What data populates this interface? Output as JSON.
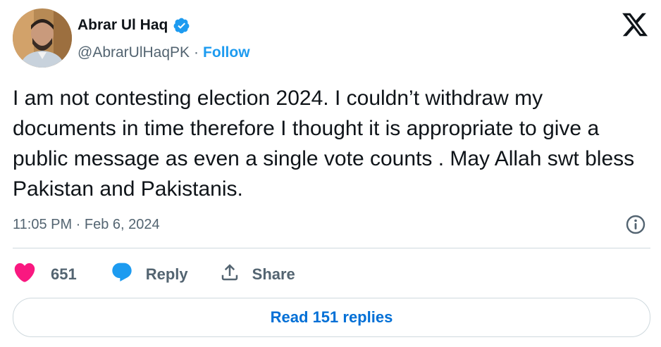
{
  "author": {
    "name": "Abrar Ul Haq",
    "handle": "@AbrarUlHaqPK",
    "separator": "·",
    "follow_label": "Follow",
    "verified": true
  },
  "tweet": {
    "text": "I am not contesting election 2024. I couldn’t withdraw my documents in time therefore I thought it is appropriate to give a public message as even a single vote counts . May Allah swt bless Pakistan and Pakistanis.",
    "timestamp": "11:05 PM · Feb 6, 2024"
  },
  "actions": {
    "like_count": "651",
    "reply_label": "Reply",
    "share_label": "Share"
  },
  "read_replies_label": "Read 151 replies",
  "icons": {
    "logo": "x-logo-icon",
    "verified": "verified-badge-icon",
    "info": "info-icon",
    "like": "heart-icon",
    "reply": "reply-bubble-icon",
    "share": "share-icon"
  },
  "colors": {
    "accent": "#1d9bf0",
    "like": "#f91880",
    "muted": "#536471",
    "link": "#006fd6"
  }
}
